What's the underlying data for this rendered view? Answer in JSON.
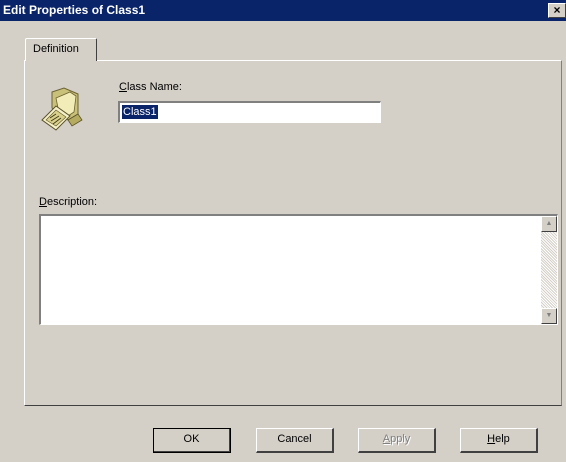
{
  "window": {
    "title": "Edit Properties of Class1",
    "close_glyph": "×"
  },
  "tabs": [
    {
      "label": "Definition"
    }
  ],
  "fields": {
    "class_name": {
      "label_prefix": "",
      "label_accel": "C",
      "label_rest": "lass Name:",
      "value": "Class1"
    },
    "description": {
      "label_accel": "D",
      "label_rest": "escription:",
      "value": ""
    }
  },
  "buttons": {
    "ok": "OK",
    "cancel": "Cancel",
    "apply_accel": "A",
    "apply_rest": "pply",
    "help_accel": "H",
    "help_rest": "elp"
  },
  "icons": {
    "class_icon": "folder-with-document-icon"
  }
}
